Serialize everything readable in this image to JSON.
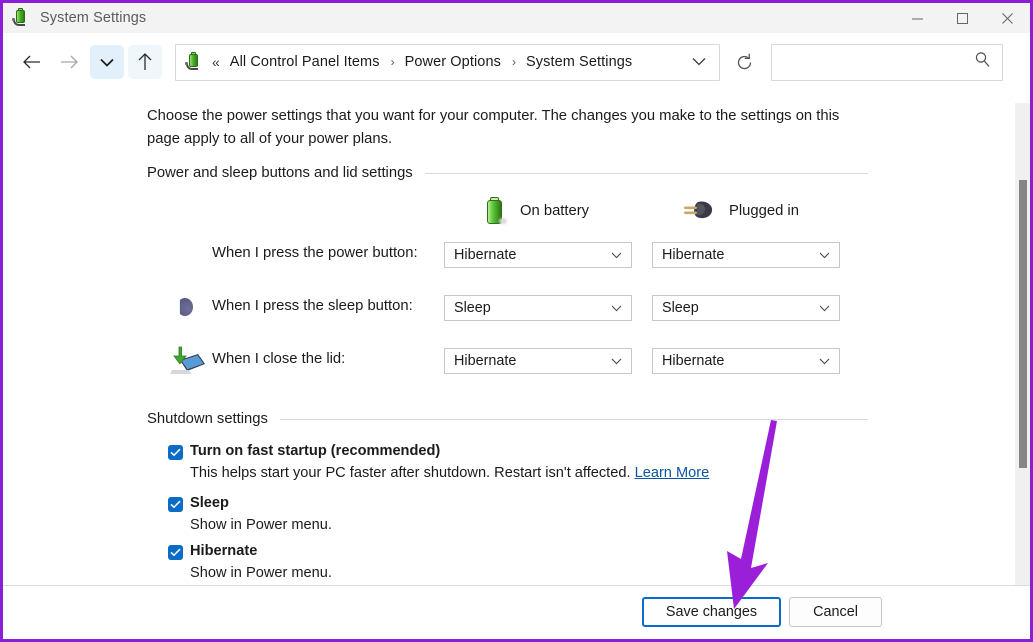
{
  "window": {
    "title": "System Settings",
    "icon": "battery-plug-icon",
    "controls": {
      "minimize": "minimize-icon",
      "maximize": "maximize-icon",
      "close": "close-icon"
    }
  },
  "nav": {
    "back": "back-arrow-icon",
    "forward": "forward-arrow-icon",
    "recent": "chevron-down-icon",
    "up": "up-arrow-icon",
    "refresh": "refresh-icon",
    "breadcrumb": {
      "icon": "battery-plug-icon",
      "overflow": "«",
      "items": [
        "All Control Panel Items",
        "Power Options",
        "System Settings"
      ],
      "separator": "›",
      "caret": "chevron-down-icon"
    },
    "search": {
      "value": "",
      "placeholder": "",
      "icon": "search-icon"
    }
  },
  "content": {
    "intro": "Choose the power settings that you want for your computer. The changes you make to the settings on this page apply to all of your power plans.",
    "section1_title": "Power and sleep buttons and lid settings",
    "columns": [
      {
        "label": "On battery",
        "icon": "battery-icon"
      },
      {
        "label": "Plugged in",
        "icon": "power-plug-icon"
      }
    ],
    "rows": [
      {
        "icon": "power-button-icon",
        "label": "When I press the power button:",
        "battery": "Hibernate",
        "plugged": "Hibernate"
      },
      {
        "icon": "sleep-button-icon",
        "label": "When I press the sleep button:",
        "battery": "Sleep",
        "plugged": "Sleep"
      },
      {
        "icon": "laptop-lid-icon",
        "label": "When I close the lid:",
        "battery": "Hibernate",
        "plugged": "Hibernate"
      }
    ],
    "section2_title": "Shutdown settings",
    "checkboxes": [
      {
        "label": "Turn on fast startup (recommended)",
        "desc": "This helps start your PC faster after shutdown. Restart isn't affected.",
        "link": "Learn More",
        "checked": true
      },
      {
        "label": "Sleep",
        "desc": "Show in Power menu.",
        "link": "",
        "checked": true
      },
      {
        "label": "Hibernate",
        "desc": "Show in Power menu.",
        "link": "",
        "checked": true
      }
    ]
  },
  "footer": {
    "save_label": "Save changes",
    "cancel_label": "Cancel"
  },
  "annotation": {
    "arrow_color": "#9b1fd9",
    "border_color": "#8b1fd6"
  }
}
